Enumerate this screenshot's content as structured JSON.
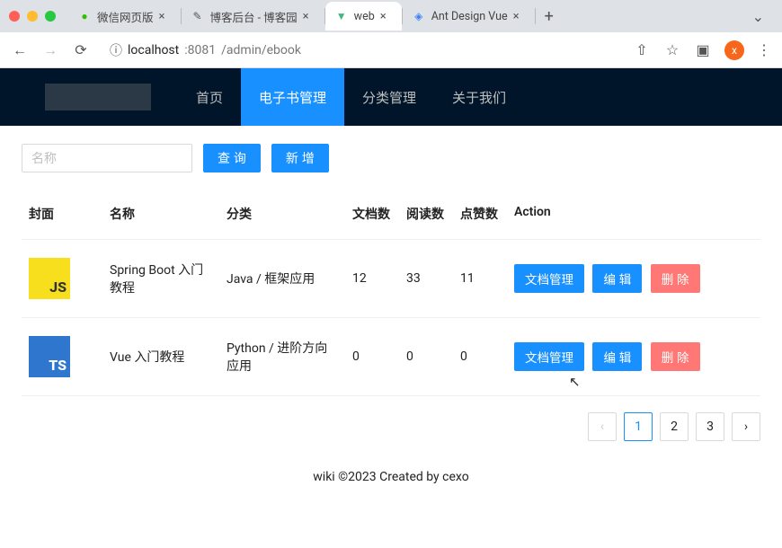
{
  "browser": {
    "tabs": [
      {
        "fav": "wechat",
        "favColor": "#2dc100",
        "title": "微信网页版",
        "active": false
      },
      {
        "fav": "blog",
        "favColor": "#555",
        "title": "博客后台 - 博客园",
        "active": false
      },
      {
        "fav": "vue",
        "favColor": "#41b883",
        "title": "web",
        "active": true
      },
      {
        "fav": "ant",
        "favColor": "#3b82f6",
        "title": "Ant Design Vue",
        "active": false
      }
    ],
    "url_host": "localhost",
    "url_port": ":8081",
    "url_path": "/admin/ebook",
    "avatar_letter": "x"
  },
  "nav": {
    "items": [
      {
        "label": "首页",
        "selected": false
      },
      {
        "label": "电子书管理",
        "selected": true
      },
      {
        "label": "分类管理",
        "selected": false
      },
      {
        "label": "关于我们",
        "selected": false
      }
    ]
  },
  "toolbar": {
    "search_placeholder": "名称",
    "search_value": "",
    "btn_query": "查 询",
    "btn_add": "新 增"
  },
  "table": {
    "headers": {
      "cover": "封面",
      "name": "名称",
      "category": "分类",
      "docs": "文档数",
      "views": "阅读数",
      "likes": "点赞数",
      "action": "Action"
    },
    "rows": [
      {
        "cover": "JS",
        "coverClass": "cover-js",
        "name": "Spring Boot 入门教程",
        "category": "Java / 框架应用",
        "docs": "12",
        "views": "33",
        "likes": "11"
      },
      {
        "cover": "TS",
        "coverClass": "cover-ts",
        "name": "Vue 入门教程",
        "category": "Python / 进阶方向应用",
        "docs": "0",
        "views": "0",
        "likes": "0"
      }
    ],
    "btn_docs": "文档管理",
    "btn_edit": "编 辑",
    "btn_delete": "删 除"
  },
  "pagination": {
    "prev": "‹",
    "pages": [
      "1",
      "2",
      "3"
    ],
    "active": "1",
    "next": "›"
  },
  "footer": "wiki ©2023 Created by cexo"
}
